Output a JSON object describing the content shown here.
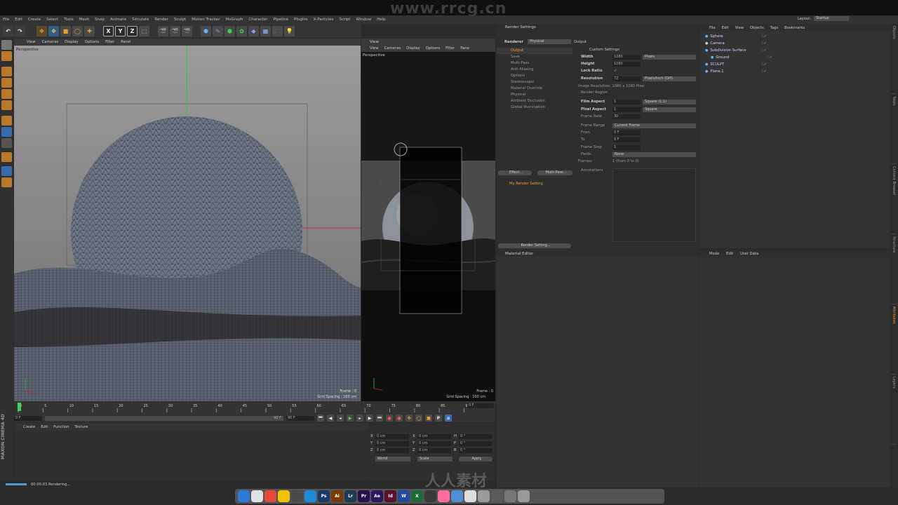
{
  "watermark": "www.rrcg.cn",
  "watermark_bottom": "人人素材",
  "menu": [
    "File",
    "Edit",
    "Create",
    "Select",
    "Tools",
    "Mesh",
    "Snap",
    "Animate",
    "Simulate",
    "Render",
    "Sculpt",
    "Motion Tracker",
    "MoGraph",
    "Character",
    "Pipeline",
    "Plugins",
    "X-Particles",
    "Script",
    "Window",
    "Help"
  ],
  "layout": {
    "label": "Layout:",
    "value": "Startup"
  },
  "viewport_left": {
    "menu": [
      "View",
      "Cameras",
      "Display",
      "Options",
      "Filter",
      "Panel"
    ],
    "name": "Perspective",
    "frame": "Frame : 0",
    "grid": "Grid Spacing : 100 cm"
  },
  "viewport_right": {
    "title": "View",
    "menu": [
      "View",
      "Cameras",
      "Display",
      "Options",
      "Filter",
      "Pane"
    ],
    "name": "Perspective",
    "frame": "Frame : 0",
    "grid": "Grid Spacing : 100 cm"
  },
  "render_settings": {
    "title": "Render Settings",
    "renderer_label": "Renderer",
    "renderer_value": "Physical",
    "items": [
      "Output",
      "Save",
      "Multi-Pass",
      "Anti-Aliasing",
      "Options",
      "Stereoscopic",
      "Material Override",
      "Physical",
      "Ambient Occlusion",
      "Global Illumination"
    ],
    "effect_btn": "Effect...",
    "multipass_btn": "Multi-Pass...",
    "setting_name": "My Render Setting",
    "render_setting_btn": "Render Setting...",
    "output": {
      "section": "Output",
      "preset": "Custom Settings",
      "width_label": "Width",
      "width": "1080",
      "width_unit": "Pixels",
      "height_label": "Height",
      "height": "1080",
      "lock_label": "Lock Ratio",
      "lock_value": "✓",
      "res_label": "Resolution",
      "res": "72",
      "res_unit": "Pixels/Inch (DPI)",
      "image_res": "Image Resolution: 1080 x 1080 Pixel",
      "region_label": "Render Region",
      "film_label": "Film Aspect",
      "film": "1",
      "film_unit": "Square (1:1)",
      "pixel_label": "Pixel Aspect",
      "pixel": "1",
      "pixel_unit": "Square",
      "fps_label": "Frame Rate",
      "fps": "30",
      "range_label": "Frame Range",
      "range": "Current Frame",
      "from_label": "From",
      "from": "0 F",
      "to_label": "To",
      "to": "0 F",
      "step_label": "Frame Step",
      "step": "1",
      "fields_label": "Fields",
      "fields": "None",
      "frames_label": "Frames:",
      "frames": "1 (from 0 to 0)",
      "annot_label": "Annotations"
    }
  },
  "objects": {
    "menu": [
      "File",
      "Edit",
      "View",
      "Objects",
      "Tags",
      "Bookmarks"
    ],
    "items": [
      "Sphere",
      "Camera",
      "Subdivision Surface",
      "Ground",
      "SCULPT",
      "Plane.1"
    ]
  },
  "material_editor": {
    "title": "Material Editor"
  },
  "attributes": {
    "menu": [
      "Mode",
      "Edit",
      "User Data"
    ]
  },
  "right_tabs": [
    "Objects",
    "Takes",
    "Content Browser",
    "Structure",
    "Attributes",
    "Layers"
  ],
  "timeline": {
    "ticks": [
      "0",
      "5",
      "10",
      "15",
      "20",
      "25",
      "30",
      "35",
      "40",
      "45",
      "50",
      "55",
      "60",
      "65",
      "70",
      "75",
      "80",
      "85",
      "90"
    ],
    "current": "0 F",
    "start": "0 F",
    "end": "90 F",
    "end2": "90 F",
    "frame_box": "0 F"
  },
  "material_menu": [
    "Create",
    "Edit",
    "Function",
    "Texture"
  ],
  "coords": {
    "x": "X",
    "y": "Y",
    "z": "Z",
    "h": "H",
    "p": "P",
    "b": "B",
    "val_cm": "0 cm",
    "val_deg": "0 °",
    "world": "World",
    "scale": "Scale",
    "apply": "Apply"
  },
  "status": "00:00:03 Rendering...",
  "brand": "MAXON CINEMA 4D",
  "dock": [
    {
      "t": "Ps",
      "c": "#1b3a6b"
    },
    {
      "t": "Ai",
      "c": "#7a3b00"
    },
    {
      "t": "Lr",
      "c": "#1d3b52"
    },
    {
      "t": "Pr",
      "c": "#2a0f4f"
    },
    {
      "t": "Ae",
      "c": "#2b1660"
    },
    {
      "t": "Id",
      "c": "#5a0f2f"
    },
    {
      "t": "W",
      "c": "#1f4aa0"
    },
    {
      "t": "X",
      "c": "#1e6b3a"
    }
  ]
}
